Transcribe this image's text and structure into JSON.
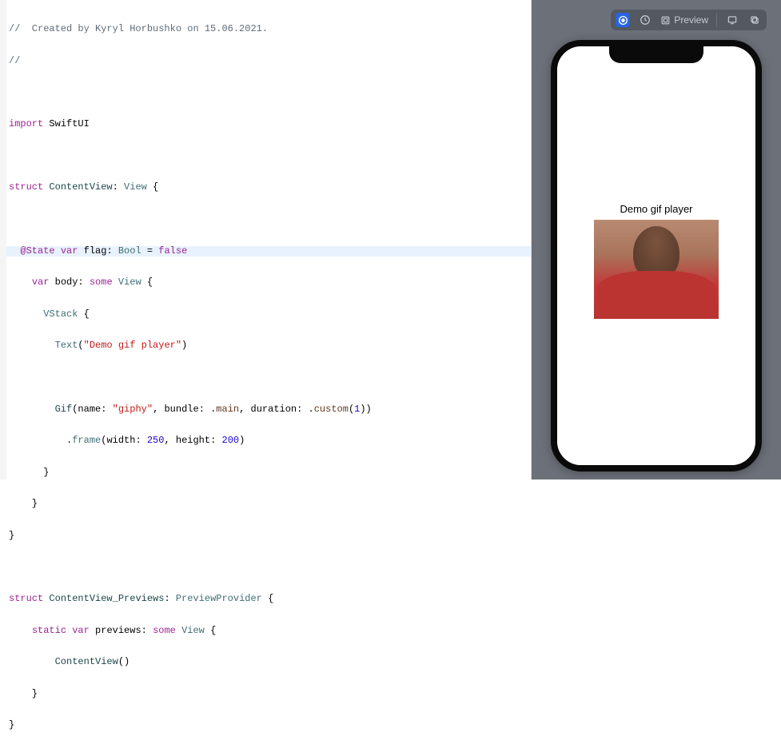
{
  "code": {
    "comment1": "//  Created by Kyryl Horbushko on 15.06.2021.",
    "comment2": "//",
    "import_kw": "import",
    "import_mod": "SwiftUI",
    "struct_kw": "struct",
    "contentview": "ContentView",
    "view_type": "View",
    "state_attr": "@State",
    "var_kw": "var",
    "flag_name": "flag",
    "bool_type": "Bool",
    "false_kw": "false",
    "body_name": "body",
    "some_kw": "some",
    "vstack": "VStack",
    "text_fn": "Text",
    "text_str": "\"Demo gif player\"",
    "gif_fn": "Gif",
    "name_label": "name",
    "giphy_str": "\"giphy\"",
    "bundle_label": "bundle",
    "main_member": "main",
    "duration_label": "duration",
    "custom_member": "custom",
    "custom_arg": "1",
    "frame_fn": "frame",
    "width_label": "width",
    "width_val": "250",
    "height_label": "height",
    "height_val": "200",
    "previews_struct": "ContentView_Previews",
    "previewprovider": "PreviewProvider",
    "static_kw": "static",
    "previews_name": "previews",
    "contentview_call": "ContentView"
  },
  "toolbar": {
    "preview_label": "Preview"
  },
  "phone": {
    "demo_text": "Demo gif player"
  }
}
